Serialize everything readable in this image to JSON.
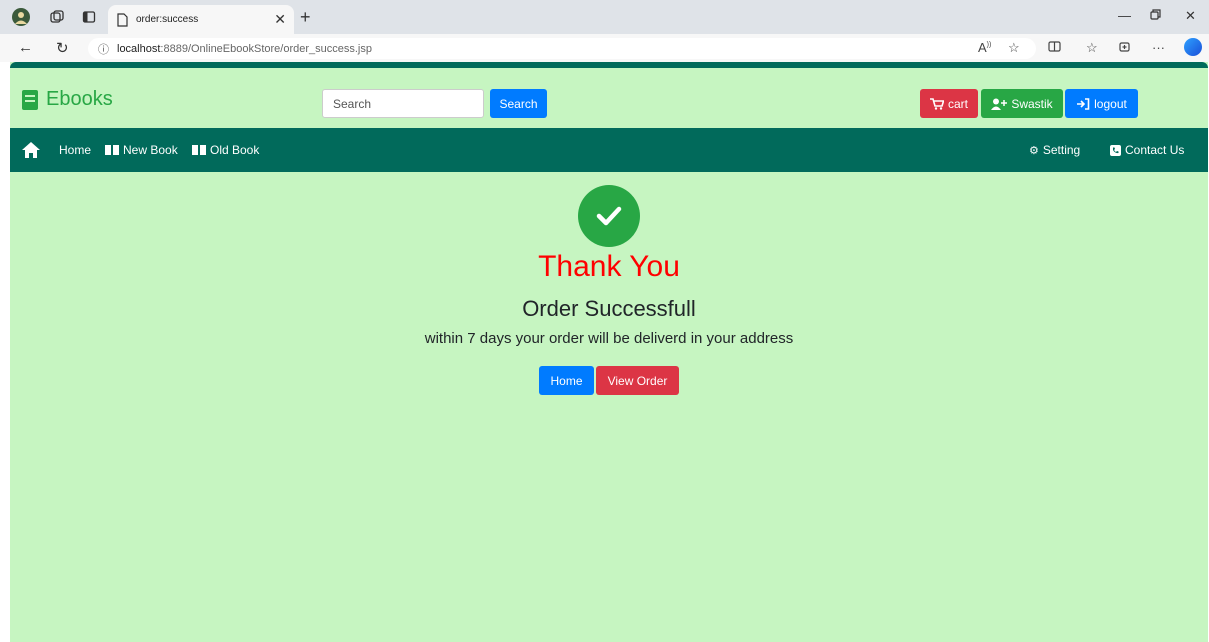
{
  "browser": {
    "tab_title": "order:success",
    "url_host": "localhost",
    "url_path": ":8889/OnlineEbookStore/order_success.jsp"
  },
  "header": {
    "brand": "Ebooks",
    "search_placeholder": "Search",
    "search_button": "Search",
    "cart_label": "cart",
    "user_label": "Swastik",
    "logout_label": "logout"
  },
  "nav": {
    "home": "Home",
    "new_book": "New Book",
    "old_book": "Old Book",
    "setting": "Setting",
    "contact": "Contact Us"
  },
  "main": {
    "thank_you": "Thank You",
    "order_status": "Order Successfull",
    "message": "within 7 days your order will be deliverd in your address",
    "home_button": "Home",
    "view_order_button": "View Order"
  },
  "colors": {
    "page_bg": "#c6f5c1",
    "navbar": "#016a5b",
    "brand": "#28a745",
    "primary": "#007bff",
    "danger": "#dc3545",
    "thank_you": "#ff0000"
  }
}
